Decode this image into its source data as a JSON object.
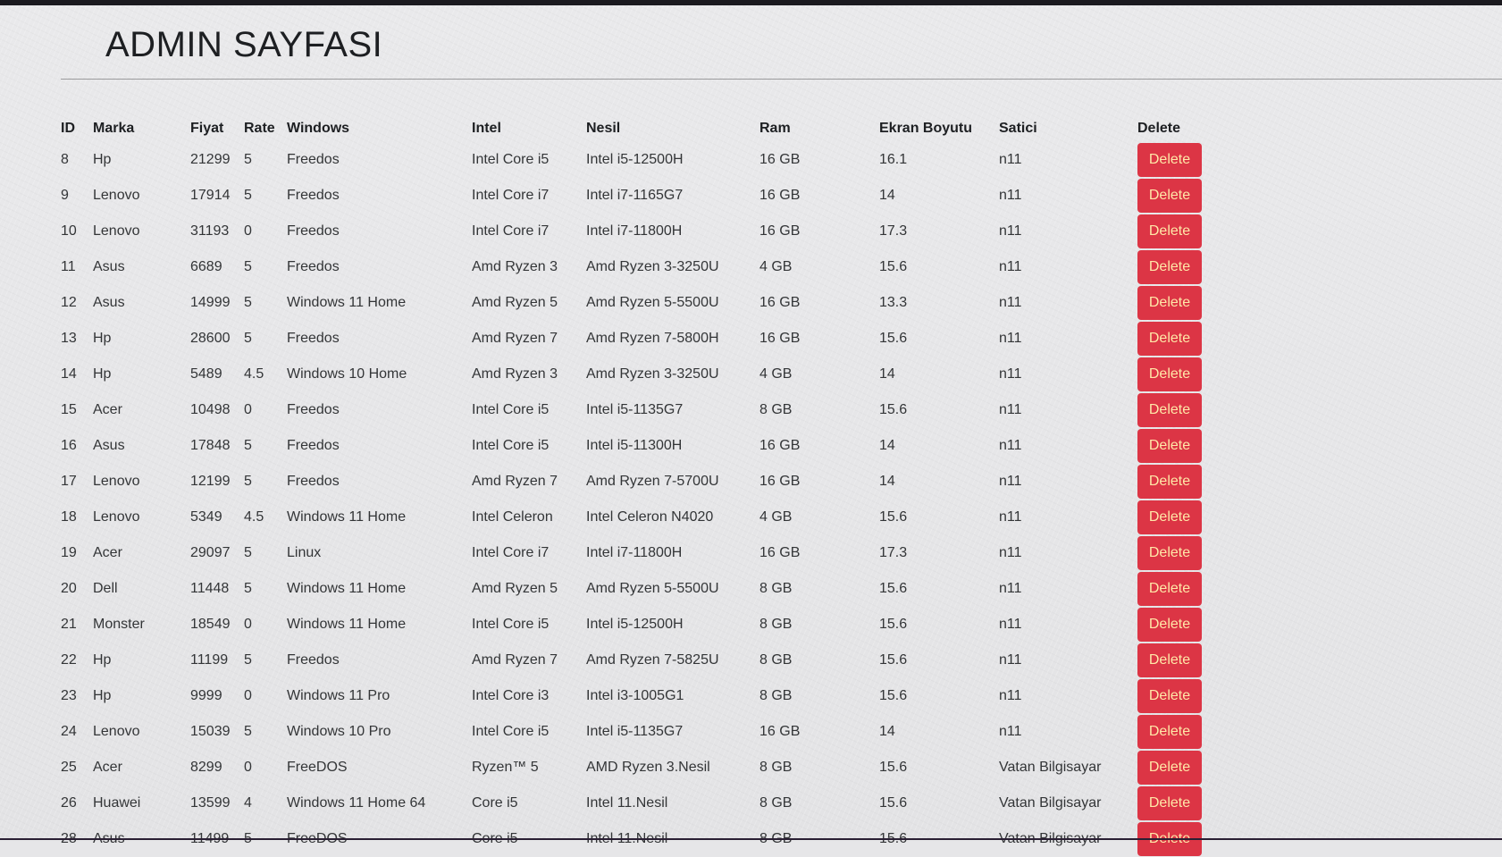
{
  "page": {
    "title": "ADMIN SAYFASI"
  },
  "table": {
    "headers": [
      "ID",
      "Marka",
      "Fiyat",
      "Rate",
      "Windows",
      "Intel",
      "Nesil",
      "Ram",
      "Ekran Boyutu",
      "Satici",
      "Delete"
    ],
    "delete_label": "Delete",
    "rows": [
      {
        "id": "8",
        "marka": "Hp",
        "fiyat": "21299",
        "rate": "5",
        "windows": "Freedos",
        "intel": "Intel Core i5",
        "nesil": "Intel i5-12500H",
        "ram": "16 GB",
        "ekran": "16.1",
        "satici": "n11"
      },
      {
        "id": "9",
        "marka": "Lenovo",
        "fiyat": "17914",
        "rate": "5",
        "windows": "Freedos",
        "intel": "Intel Core i7",
        "nesil": "Intel i7-1165G7",
        "ram": "16 GB",
        "ekran": "14",
        "satici": "n11"
      },
      {
        "id": "10",
        "marka": "Lenovo",
        "fiyat": "31193",
        "rate": "0",
        "windows": "Freedos",
        "intel": "Intel Core i7",
        "nesil": "Intel i7-11800H",
        "ram": "16 GB",
        "ekran": "17.3",
        "satici": "n11"
      },
      {
        "id": "11",
        "marka": "Asus",
        "fiyat": "6689",
        "rate": "5",
        "windows": "Freedos",
        "intel": "Amd Ryzen 3",
        "nesil": "Amd Ryzen 3-3250U",
        "ram": "4 GB",
        "ekran": "15.6",
        "satici": "n11"
      },
      {
        "id": "12",
        "marka": "Asus",
        "fiyat": "14999",
        "rate": "5",
        "windows": "Windows 11 Home",
        "intel": "Amd Ryzen 5",
        "nesil": "Amd Ryzen 5-5500U",
        "ram": "16 GB",
        "ekran": "13.3",
        "satici": "n11"
      },
      {
        "id": "13",
        "marka": "Hp",
        "fiyat": "28600",
        "rate": "5",
        "windows": "Freedos",
        "intel": "Amd Ryzen 7",
        "nesil": "Amd Ryzen 7-5800H",
        "ram": "16 GB",
        "ekran": "15.6",
        "satici": "n11"
      },
      {
        "id": "14",
        "marka": "Hp",
        "fiyat": "5489",
        "rate": "4.5",
        "windows": "Windows 10 Home",
        "intel": "Amd Ryzen 3",
        "nesil": "Amd Ryzen 3-3250U",
        "ram": "4 GB",
        "ekran": "14",
        "satici": "n11"
      },
      {
        "id": "15",
        "marka": "Acer",
        "fiyat": "10498",
        "rate": "0",
        "windows": "Freedos",
        "intel": "Intel Core i5",
        "nesil": "Intel i5-1135G7",
        "ram": "8 GB",
        "ekran": "15.6",
        "satici": "n11"
      },
      {
        "id": "16",
        "marka": "Asus",
        "fiyat": "17848",
        "rate": "5",
        "windows": "Freedos",
        "intel": "Intel Core i5",
        "nesil": "Intel i5-11300H",
        "ram": "16 GB",
        "ekran": "14",
        "satici": "n11"
      },
      {
        "id": "17",
        "marka": "Lenovo",
        "fiyat": "12199",
        "rate": "5",
        "windows": "Freedos",
        "intel": "Amd Ryzen 7",
        "nesil": "Amd Ryzen 7-5700U",
        "ram": "16 GB",
        "ekran": "14",
        "satici": "n11"
      },
      {
        "id": "18",
        "marka": "Lenovo",
        "fiyat": "5349",
        "rate": "4.5",
        "windows": "Windows 11 Home",
        "intel": "Intel Celeron",
        "nesil": "Intel Celeron N4020",
        "ram": "4 GB",
        "ekran": "15.6",
        "satici": "n11"
      },
      {
        "id": "19",
        "marka": "Acer",
        "fiyat": "29097",
        "rate": "5",
        "windows": "Linux",
        "intel": "Intel Core i7",
        "nesil": "Intel i7-11800H",
        "ram": "16 GB",
        "ekran": "17.3",
        "satici": "n11"
      },
      {
        "id": "20",
        "marka": "Dell",
        "fiyat": "11448",
        "rate": "5",
        "windows": "Windows 11 Home",
        "intel": "Amd Ryzen 5",
        "nesil": "Amd Ryzen 5-5500U",
        "ram": "8 GB",
        "ekran": "15.6",
        "satici": "n11"
      },
      {
        "id": "21",
        "marka": "Monster",
        "fiyat": "18549",
        "rate": "0",
        "windows": "Windows 11 Home",
        "intel": "Intel Core i5",
        "nesil": "Intel i5-12500H",
        "ram": "8 GB",
        "ekran": "15.6",
        "satici": "n11"
      },
      {
        "id": "22",
        "marka": "Hp",
        "fiyat": "11199",
        "rate": "5",
        "windows": "Freedos",
        "intel": "Amd Ryzen 7",
        "nesil": "Amd Ryzen 7-5825U",
        "ram": "8 GB",
        "ekran": "15.6",
        "satici": "n11"
      },
      {
        "id": "23",
        "marka": "Hp",
        "fiyat": "9999",
        "rate": "0",
        "windows": "Windows 11 Pro",
        "intel": "Intel Core i3",
        "nesil": "Intel i3-1005G1",
        "ram": "8 GB",
        "ekran": "15.6",
        "satici": "n11"
      },
      {
        "id": "24",
        "marka": "Lenovo",
        "fiyat": "15039",
        "rate": "5",
        "windows": "Windows 10 Pro",
        "intel": "Intel Core i5",
        "nesil": "Intel i5-1135G7",
        "ram": "16 GB",
        "ekran": "14",
        "satici": "n11"
      },
      {
        "id": "25",
        "marka": "Acer",
        "fiyat": "8299",
        "rate": "0",
        "windows": "FreeDOS",
        "intel": "Ryzen™ 5",
        "nesil": "AMD Ryzen 3.Nesil",
        "ram": "8 GB",
        "ekran": "15.6",
        "satici": "Vatan Bilgisayar"
      },
      {
        "id": "26",
        "marka": "Huawei",
        "fiyat": "13599",
        "rate": "4",
        "windows": "Windows 11 Home 64",
        "intel": "Core i5",
        "nesil": "Intel 11.Nesil",
        "ram": "8 GB",
        "ekran": "15.6",
        "satici": "Vatan Bilgisayar"
      },
      {
        "id": "28",
        "marka": "Asus",
        "fiyat": "11499",
        "rate": "5",
        "windows": "FreeDOS",
        "intel": "Core i5",
        "nesil": "Intel 11.Nesil",
        "ram": "8 GB",
        "ekran": "15.6",
        "satici": "Vatan Bilgisayar"
      }
    ]
  },
  "colors": {
    "background": "#e6e6e8",
    "delete_button": "#dc3545",
    "delete_text": "#ffe8a8",
    "top_bar": "#1b1a1f"
  }
}
